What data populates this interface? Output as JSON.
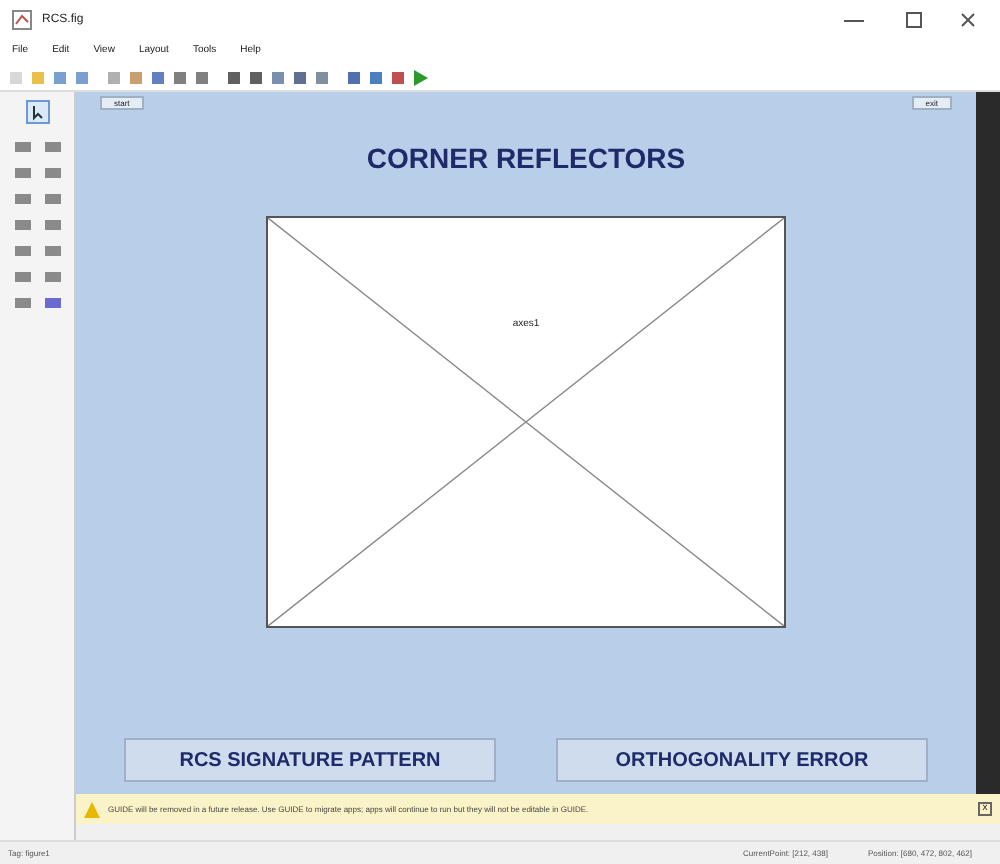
{
  "window": {
    "title": "RCS.fig"
  },
  "menu": [
    "File",
    "Edit",
    "View",
    "Layout",
    "Tools",
    "Help"
  ],
  "canvas": {
    "top_buttons": [
      {
        "label": "start"
      },
      {
        "label": "exit"
      }
    ],
    "heading": "CORNER REFLECTORS",
    "axes": {
      "label": "axes1"
    },
    "bottom_buttons": [
      {
        "label": "RCS SIGNATURE PATTERN"
      },
      {
        "label": "ORTHOGONALITY ERROR"
      }
    ]
  },
  "banner": {
    "text": "GUIDE will be removed in a future release. Use GUIDE to migrate apps; apps will continue to run but they will not be editable in GUIDE.",
    "link": "x"
  },
  "status_bar": {
    "tag": "Tag: figure1",
    "current_point": "CurrentPoint: [212, 438]",
    "position": "Position: [680, 472, 802, 462]"
  }
}
